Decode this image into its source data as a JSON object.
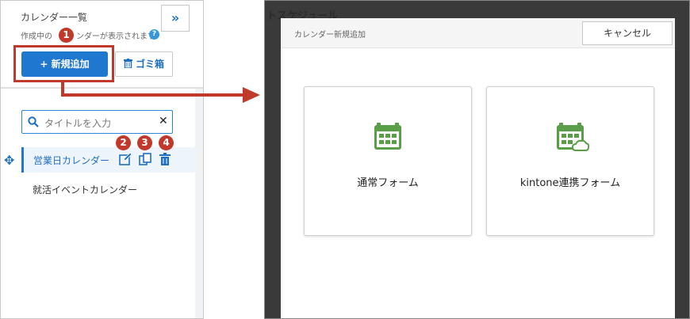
{
  "left_panel": {
    "title": "カレンダー一覧",
    "subtitle_before": "作成中の",
    "subtitle_after": "ンダーが表示されます",
    "help_glyph": "?",
    "collapse_glyph": "»",
    "add_button_label": "+ 新規追加",
    "trash_button_label": "ゴミ箱",
    "search": {
      "placeholder": "タイトルを入力",
      "clear_glyph": "✕"
    },
    "calendars": [
      {
        "label": "営業日カレンダー",
        "active": true
      },
      {
        "label": "就活イベントカレンダー",
        "active": false
      }
    ],
    "move_glyph": "✥"
  },
  "badges": [
    "1",
    "2",
    "3",
    "4"
  ],
  "colors": {
    "accent_blue": "#1f77d0",
    "highlight_red": "#c0392b",
    "calendar_green": "#5a9e4a"
  },
  "modal": {
    "background_title": "トスケジュール",
    "title": "カレンダー新規追加",
    "cancel_label": "キャンセル",
    "cards": [
      {
        "label": "通常フォーム",
        "icon": "calendar-icon"
      },
      {
        "label": "kintone連携フォーム",
        "icon": "calendar-cloud-icon"
      }
    ]
  }
}
